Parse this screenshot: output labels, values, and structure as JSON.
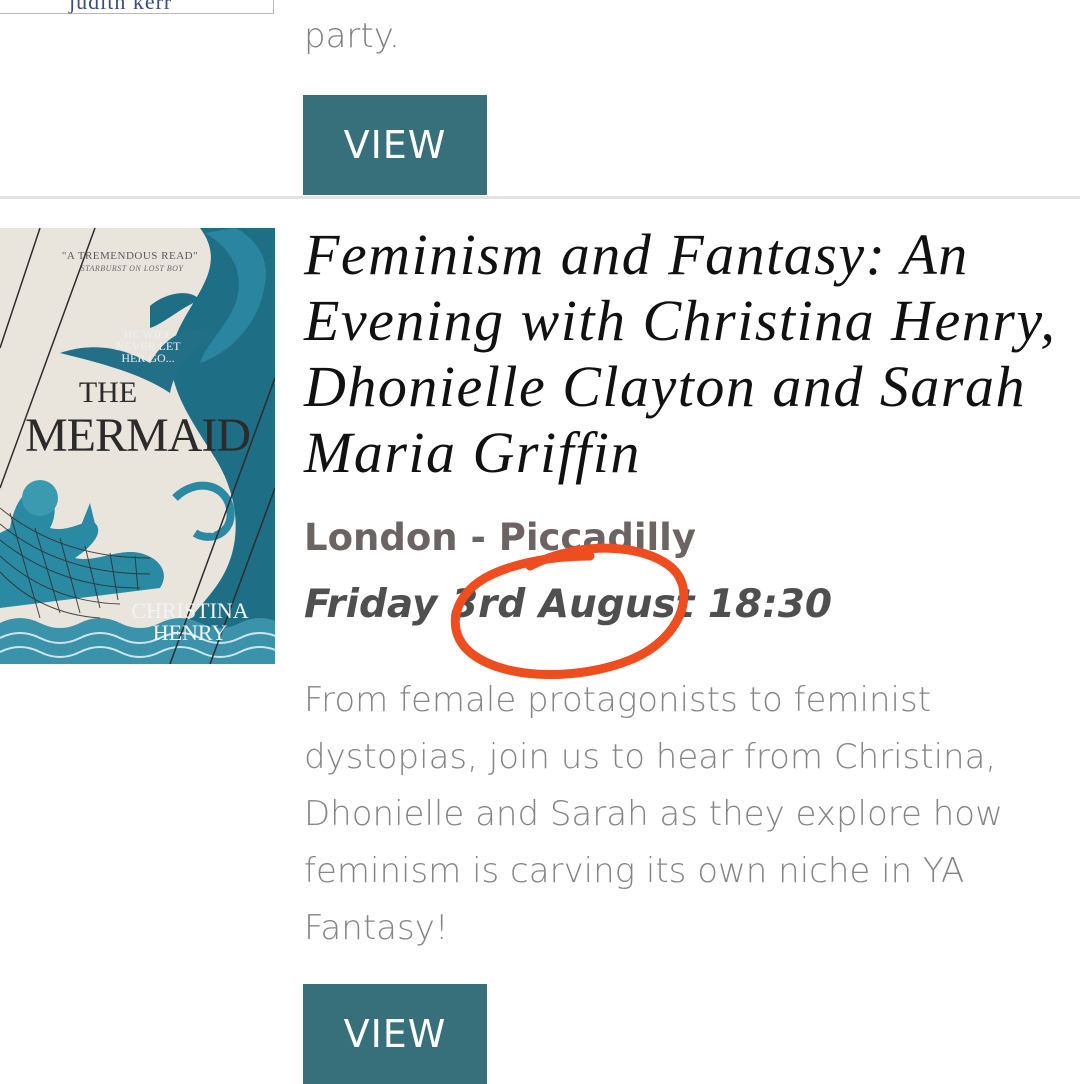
{
  "previous_event": {
    "author_cut_text": "judith kerr",
    "description_end": "party.",
    "view_label": "VIEW"
  },
  "event": {
    "cover": {
      "quote": "\"A TREMENDOUS READ\"",
      "quote_source": "STARBURST ON LOST BOY",
      "tagline": "HE WILL NEVER LET HER GO...",
      "title_small": "THE",
      "title": "MERMAID",
      "author": "CHRISTINA HENRY"
    },
    "title": "Feminism and Fantasy: An Evening with Christina Henry, Dhonielle Clayton and Sarah Maria Griffin",
    "location": "London - Piccadilly",
    "date": "Friday 3rd August 18:30",
    "description": "From female protagonists to feminist dystopias, join us to hear from Christina, Dhonielle and Sarah as they explore how feminism is carving its own niche in YA Fantasy!",
    "view_label": "VIEW"
  },
  "colors": {
    "button": "#37707b",
    "annotation_circle": "#ee4d1f",
    "cover_teal": "#1e6f86"
  },
  "icons": [
    "hand-drawn-circle-annotation"
  ]
}
